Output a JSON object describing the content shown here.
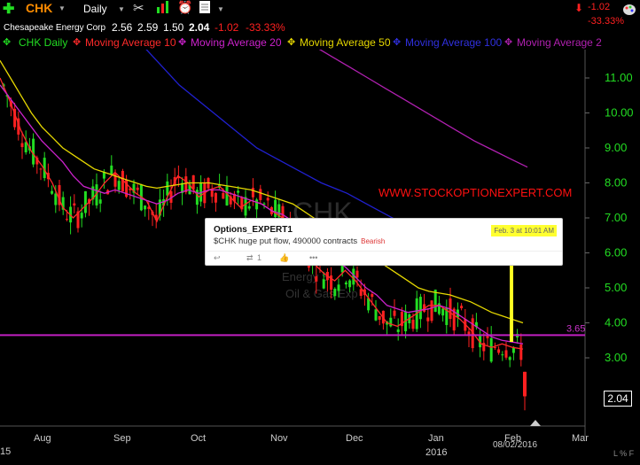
{
  "toolbar": {
    "symbol": "CHK",
    "period": "Daily",
    "change_top": "-1.02",
    "change_pct_top": "-33.33%"
  },
  "info": {
    "company": "Chesapeake Energy Corp",
    "open": "2.56",
    "high": "2.59",
    "low": "1.50",
    "close": "2.04",
    "change": "-1.02",
    "change_pct": "-33.33%"
  },
  "legend": {
    "main": "CHK Daily",
    "ma10": "Moving Average 10",
    "ma20": "Moving Average 20",
    "ma50": "Moving Average 50",
    "ma100": "Moving Average 100",
    "ma200": "Moving Average 2"
  },
  "colors": {
    "up": "#22dd22",
    "down": "#ff2020",
    "ma10": "#ff2a2a",
    "ma20": "#cc22cc",
    "ma50": "#e6d800",
    "ma100": "#2020d0",
    "ma200": "#b020b0",
    "hline": "#c020c0",
    "watermark_red": "#ff1010",
    "highlight": "#ffff22"
  },
  "watermark": {
    "url": "WWW.STOCKOPTIONEXPERT.COM",
    "sector1": "Energy S",
    "sector2": "Oil & Gas Exp",
    "ticker_ghost": "CHK"
  },
  "annotation": {
    "level": "3.65",
    "last_price": "2.04",
    "date_label": "08/02/2016"
  },
  "tweet": {
    "author": "Options_EXPERT1",
    "text": "$CHK huge put flow, 490000 contracts",
    "tag": "Bearish",
    "time": "Feb. 3 at 10:01 AM",
    "retweets": "1",
    "more": "•••"
  },
  "axis": {
    "left_year": "15",
    "bottom_year": "2016",
    "corner": "L % F"
  },
  "chart_data": {
    "type": "line",
    "title": "CHK Daily",
    "y_ticks": [
      3.0,
      4.0,
      5.0,
      6.0,
      7.0,
      8.0,
      9.0,
      10.0,
      11.0
    ],
    "y_tick_labels": [
      "3.00",
      "4.00",
      "5.00",
      "6.00",
      "7.00",
      "8.00",
      "9.00",
      "10.00",
      "11.00"
    ],
    "ylim": [
      1.5,
      12.0
    ],
    "x_tick_labels": [
      "Aug",
      "Sep",
      "Oct",
      "Nov",
      "Dec",
      "Jan",
      "Feb",
      "Mar"
    ],
    "grid": false,
    "legend_position": "top-left",
    "horizontal_line": 3.65,
    "series": [
      {
        "name": "Moving Average 10",
        "values": [
          11.0,
          10.3,
          9.5,
          8.9,
          8.5,
          8.0,
          7.3,
          7.0,
          7.3,
          7.6,
          8.0,
          8.3,
          8.0,
          7.7,
          7.5,
          6.9,
          7.6,
          8.2,
          8.0,
          7.6,
          7.8,
          7.9,
          7.6,
          7.3,
          7.5,
          7.4,
          7.2,
          7.0,
          6.6,
          6.2,
          5.7,
          5.4,
          5.2,
          5.5,
          5.2,
          4.8,
          4.4,
          4.0,
          3.9,
          4.1,
          4.3,
          4.5,
          4.5,
          4.3,
          4.1,
          3.8,
          3.4,
          3.3,
          3.4,
          3.3,
          3.25
        ]
      },
      {
        "name": "Moving Average 20",
        "values": [
          10.8,
          10.4,
          10.0,
          9.6,
          9.2,
          8.9,
          8.6,
          8.2,
          7.9,
          7.8,
          7.7,
          7.8,
          7.7,
          7.6,
          7.5,
          7.4,
          7.5,
          7.7,
          7.8,
          7.7,
          7.8,
          7.8,
          7.7,
          7.6,
          7.5,
          7.4,
          7.2,
          7.1,
          6.9,
          6.6,
          6.3,
          6.0,
          5.8,
          5.6,
          5.3,
          5.0,
          4.8,
          4.5,
          4.4,
          4.3,
          4.35,
          4.4,
          4.5,
          4.4,
          4.2,
          4.0,
          3.8,
          3.6,
          3.5,
          3.45,
          3.4
        ]
      },
      {
        "name": "Moving Average 50",
        "values": [
          11.5,
          11.0,
          10.5,
          10.0,
          9.6,
          9.3,
          9.0,
          8.8,
          8.6,
          8.4,
          8.3,
          8.2,
          8.1,
          8.0,
          7.9,
          7.85,
          7.9,
          7.95,
          8.0,
          8.0,
          8.0,
          7.95,
          7.9,
          7.85,
          7.8,
          7.7,
          7.6,
          7.5,
          7.4,
          7.2,
          7.0,
          6.8,
          6.6,
          6.4,
          6.2,
          6.0,
          5.8,
          5.6,
          5.4,
          5.2,
          5.0,
          4.9,
          4.85,
          4.8,
          4.7,
          4.6,
          4.45,
          4.3,
          4.2,
          4.1,
          4.0
        ]
      },
      {
        "name": "Moving Average 100",
        "values": [
          14.2,
          13.6,
          13.0,
          12.5,
          12.0,
          11.6,
          11.2,
          10.8,
          10.5,
          10.2,
          9.9,
          9.6,
          9.3,
          9.0,
          8.8,
          8.6,
          8.4,
          8.2,
          8.0,
          7.85,
          7.7,
          7.5,
          7.3,
          7.1,
          6.9
        ]
      },
      {
        "name": "Moving Average 2",
        "values": [
          11.9,
          11.6,
          11.3,
          11.0,
          10.7,
          10.4,
          10.1,
          9.8,
          9.5,
          9.2,
          8.95,
          8.7,
          8.45
        ]
      }
    ]
  }
}
